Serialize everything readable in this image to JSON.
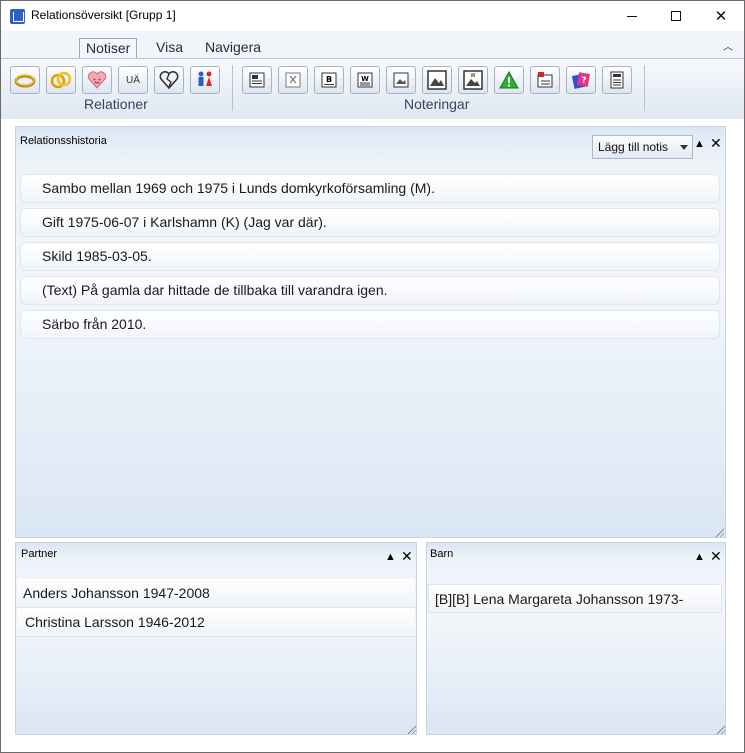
{
  "window": {
    "title": "Relationsöversikt [Grupp 1]"
  },
  "ribbon": {
    "tabs": [
      {
        "label": "Notiser",
        "active": true
      },
      {
        "label": "Visa",
        "active": false
      },
      {
        "label": "Navigera",
        "active": false
      }
    ],
    "groups": {
      "relationer": {
        "label": "Relationer",
        "buttons": [
          {
            "icon": "ring-icon"
          },
          {
            "icon": "wedding-rings-icon"
          },
          {
            "icon": "heart-icon"
          },
          {
            "icon": "ua-text-icon",
            "text": "UÄ"
          },
          {
            "icon": "broken-heart-icon"
          },
          {
            "icon": "couple-icon"
          }
        ]
      },
      "noteringar": {
        "label": "Noteringar",
        "buttons": [
          {
            "icon": "note-icon"
          },
          {
            "icon": "note-x-icon"
          },
          {
            "icon": "note-b-icon"
          },
          {
            "icon": "note-w-icon"
          },
          {
            "icon": "image-note-icon"
          },
          {
            "icon": "image-frame-icon"
          },
          {
            "icon": "image-text-icon"
          },
          {
            "icon": "warning-icon"
          },
          {
            "icon": "note-flag-icon"
          },
          {
            "icon": "question-card-icon"
          },
          {
            "icon": "document-icon"
          }
        ]
      }
    }
  },
  "relationshistoria": {
    "title": "Relationsshistoria",
    "add_button": "Lägg till notis",
    "notes": [
      "Sambo mellan 1969 och 1975 i Lunds domkyrkoförsamling (M).",
      "Gift 1975-06-07 i Karlshamn (K) (Jag var där).",
      "Skild 1985-03-05.",
      "(Text) På gamla dar hittade de tillbaka till varandra igen.",
      "Särbo från 2010."
    ]
  },
  "partner": {
    "title": "Partner",
    "rows": [
      "Anders  Johansson  1947-2008",
      "Christina  Larsson  1946-2012"
    ]
  },
  "barn": {
    "title": "Barn",
    "rows": [
      "[B][B] Lena Margareta Johansson 1973-"
    ]
  },
  "colors": {
    "accent": "#2f5ec4",
    "pane_blue": "#dbe6f4"
  }
}
